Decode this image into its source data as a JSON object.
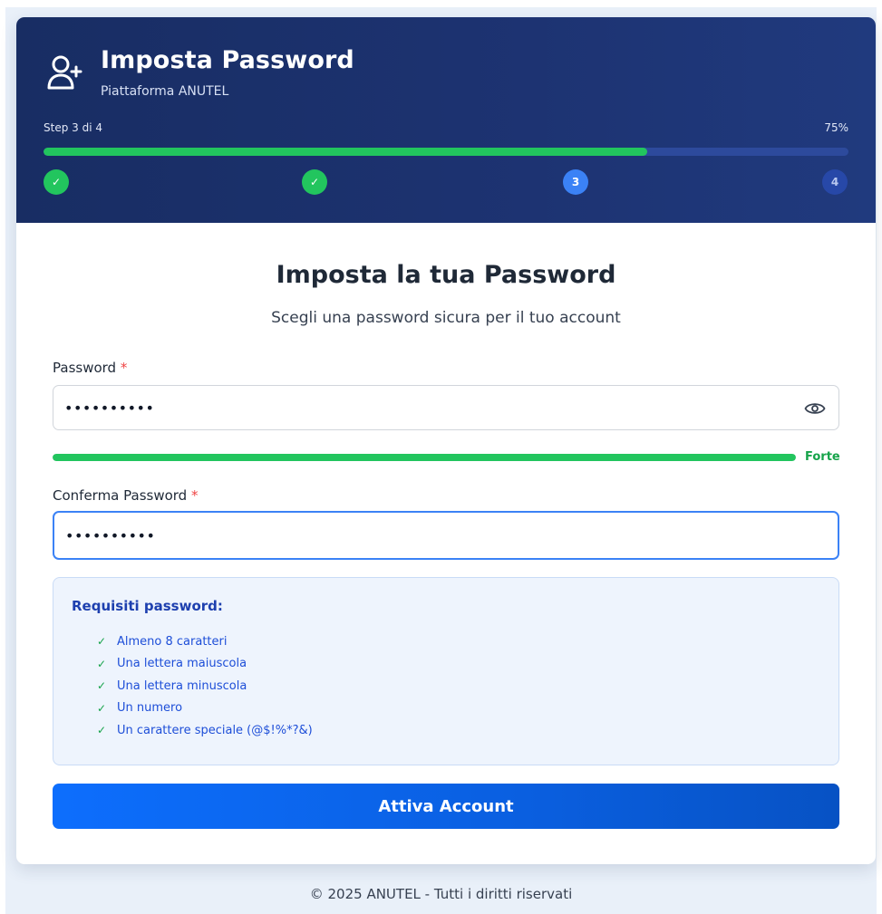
{
  "header": {
    "title": "Imposta Password",
    "subtitle": "Piattaforma ANUTEL",
    "icon": "user-plus-icon",
    "step_text": "Step 3 di 4",
    "percent_text": "75%",
    "progress": 0.75,
    "steps": [
      {
        "label": "✓",
        "status": "done"
      },
      {
        "label": "✓",
        "status": "done"
      },
      {
        "label": "3",
        "status": "current"
      },
      {
        "label": "4",
        "status": "pending"
      }
    ]
  },
  "form": {
    "title": "Imposta la tua Password",
    "subtitle": "Scegli una password sicura per il tuo account",
    "required_marker": "*",
    "password": {
      "label": "Password",
      "value": "••••••••••",
      "toggle_icon": "eye-icon"
    },
    "strength": {
      "level": 1.0,
      "label": "Forte"
    },
    "confirm": {
      "label": "Conferma Password",
      "value": "••••••••••"
    },
    "requirements": {
      "title": "Requisiti password:",
      "check": "✓",
      "items": [
        "Almeno 8 caratteri",
        "Una lettera maiuscola",
        "Una lettera minuscola",
        "Un numero",
        "Un carattere speciale (@$!%*?&)"
      ]
    },
    "submit_label": "Attiva Account"
  },
  "footer": {
    "text": "© 2025 ANUTEL - Tutti i diritti riservati"
  },
  "colors": {
    "header_bg": "#1d3372",
    "success": "#22c55e",
    "primary": "#0d6efd",
    "step_current": "#3b82f6",
    "required": "#ef4444"
  }
}
